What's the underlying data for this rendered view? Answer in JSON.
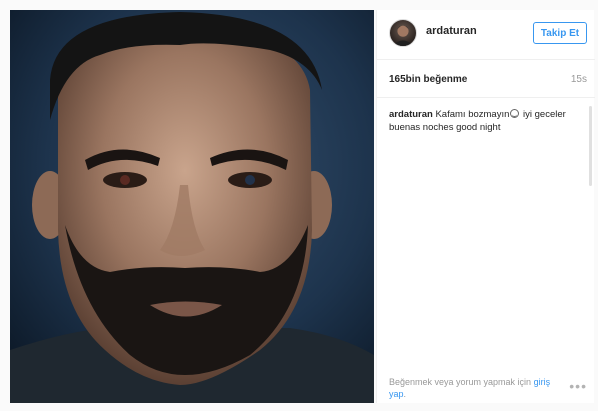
{
  "post": {
    "username": "ardaturan",
    "follow_label": "Takip Et",
    "likes": "165bin beğenme",
    "time": "15s",
    "caption_user": "ardaturan",
    "caption_part1": "Kafamı bozmayın",
    "caption_part2": "iyi geceler buenas noches good night",
    "login_prefix": "Beğenmek veya yorum yapmak için",
    "login_link": "giriş yap",
    "login_suffix": ".",
    "more_label": "•••"
  },
  "colors": {
    "accent": "#3897f0",
    "muted": "#999999",
    "text": "#262626"
  },
  "icons": {
    "avatar": "profile-avatar",
    "more": "more-dots-icon",
    "emoji": "smiley-icon"
  }
}
